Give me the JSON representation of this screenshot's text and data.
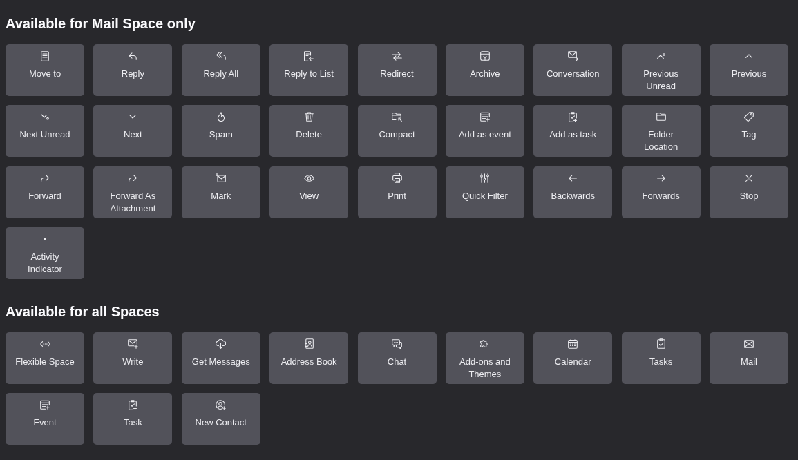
{
  "sections": [
    {
      "title": "Available for Mail Space only",
      "buttons": [
        "Move to",
        "Reply",
        "Reply All",
        "Reply to List",
        "Redirect",
        "Archive",
        "Conversation",
        "Previous Unread",
        "Previous",
        "Next Unread",
        "Next",
        "Spam",
        "Delete",
        "Compact",
        "Add as event",
        "Add as task",
        "Folder Location",
        "Tag",
        "Forward",
        "Forward As Attachment",
        "Mark",
        "View",
        "Print",
        "Quick Filter",
        "Backwards",
        "Forwards",
        "Stop",
        "Activity Indicator"
      ]
    },
    {
      "title": "Available for all Spaces",
      "buttons": [
        "Flexible Space",
        "Write",
        "Get Messages",
        "Address Book",
        "Chat",
        "Add-ons and Themes",
        "Calendar",
        "Tasks",
        "Mail",
        "Event",
        "Task",
        "New Contact"
      ]
    }
  ]
}
